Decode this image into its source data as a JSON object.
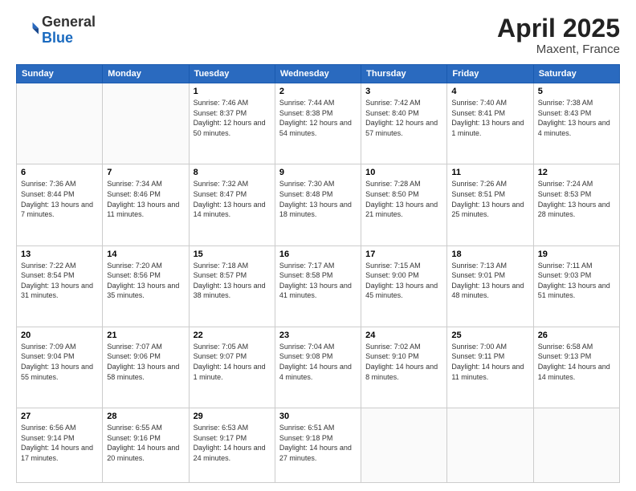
{
  "header": {
    "logo_line1": "General",
    "logo_line2": "Blue",
    "month": "April 2025",
    "location": "Maxent, France"
  },
  "weekdays": [
    "Sunday",
    "Monday",
    "Tuesday",
    "Wednesday",
    "Thursday",
    "Friday",
    "Saturday"
  ],
  "weeks": [
    [
      {
        "day": "",
        "info": ""
      },
      {
        "day": "",
        "info": ""
      },
      {
        "day": "1",
        "info": "Sunrise: 7:46 AM\nSunset: 8:37 PM\nDaylight: 12 hours and 50 minutes."
      },
      {
        "day": "2",
        "info": "Sunrise: 7:44 AM\nSunset: 8:38 PM\nDaylight: 12 hours and 54 minutes."
      },
      {
        "day": "3",
        "info": "Sunrise: 7:42 AM\nSunset: 8:40 PM\nDaylight: 12 hours and 57 minutes."
      },
      {
        "day": "4",
        "info": "Sunrise: 7:40 AM\nSunset: 8:41 PM\nDaylight: 13 hours and 1 minute."
      },
      {
        "day": "5",
        "info": "Sunrise: 7:38 AM\nSunset: 8:43 PM\nDaylight: 13 hours and 4 minutes."
      }
    ],
    [
      {
        "day": "6",
        "info": "Sunrise: 7:36 AM\nSunset: 8:44 PM\nDaylight: 13 hours and 7 minutes."
      },
      {
        "day": "7",
        "info": "Sunrise: 7:34 AM\nSunset: 8:46 PM\nDaylight: 13 hours and 11 minutes."
      },
      {
        "day": "8",
        "info": "Sunrise: 7:32 AM\nSunset: 8:47 PM\nDaylight: 13 hours and 14 minutes."
      },
      {
        "day": "9",
        "info": "Sunrise: 7:30 AM\nSunset: 8:48 PM\nDaylight: 13 hours and 18 minutes."
      },
      {
        "day": "10",
        "info": "Sunrise: 7:28 AM\nSunset: 8:50 PM\nDaylight: 13 hours and 21 minutes."
      },
      {
        "day": "11",
        "info": "Sunrise: 7:26 AM\nSunset: 8:51 PM\nDaylight: 13 hours and 25 minutes."
      },
      {
        "day": "12",
        "info": "Sunrise: 7:24 AM\nSunset: 8:53 PM\nDaylight: 13 hours and 28 minutes."
      }
    ],
    [
      {
        "day": "13",
        "info": "Sunrise: 7:22 AM\nSunset: 8:54 PM\nDaylight: 13 hours and 31 minutes."
      },
      {
        "day": "14",
        "info": "Sunrise: 7:20 AM\nSunset: 8:56 PM\nDaylight: 13 hours and 35 minutes."
      },
      {
        "day": "15",
        "info": "Sunrise: 7:18 AM\nSunset: 8:57 PM\nDaylight: 13 hours and 38 minutes."
      },
      {
        "day": "16",
        "info": "Sunrise: 7:17 AM\nSunset: 8:58 PM\nDaylight: 13 hours and 41 minutes."
      },
      {
        "day": "17",
        "info": "Sunrise: 7:15 AM\nSunset: 9:00 PM\nDaylight: 13 hours and 45 minutes."
      },
      {
        "day": "18",
        "info": "Sunrise: 7:13 AM\nSunset: 9:01 PM\nDaylight: 13 hours and 48 minutes."
      },
      {
        "day": "19",
        "info": "Sunrise: 7:11 AM\nSunset: 9:03 PM\nDaylight: 13 hours and 51 minutes."
      }
    ],
    [
      {
        "day": "20",
        "info": "Sunrise: 7:09 AM\nSunset: 9:04 PM\nDaylight: 13 hours and 55 minutes."
      },
      {
        "day": "21",
        "info": "Sunrise: 7:07 AM\nSunset: 9:06 PM\nDaylight: 13 hours and 58 minutes."
      },
      {
        "day": "22",
        "info": "Sunrise: 7:05 AM\nSunset: 9:07 PM\nDaylight: 14 hours and 1 minute."
      },
      {
        "day": "23",
        "info": "Sunrise: 7:04 AM\nSunset: 9:08 PM\nDaylight: 14 hours and 4 minutes."
      },
      {
        "day": "24",
        "info": "Sunrise: 7:02 AM\nSunset: 9:10 PM\nDaylight: 14 hours and 8 minutes."
      },
      {
        "day": "25",
        "info": "Sunrise: 7:00 AM\nSunset: 9:11 PM\nDaylight: 14 hours and 11 minutes."
      },
      {
        "day": "26",
        "info": "Sunrise: 6:58 AM\nSunset: 9:13 PM\nDaylight: 14 hours and 14 minutes."
      }
    ],
    [
      {
        "day": "27",
        "info": "Sunrise: 6:56 AM\nSunset: 9:14 PM\nDaylight: 14 hours and 17 minutes."
      },
      {
        "day": "28",
        "info": "Sunrise: 6:55 AM\nSunset: 9:16 PM\nDaylight: 14 hours and 20 minutes."
      },
      {
        "day": "29",
        "info": "Sunrise: 6:53 AM\nSunset: 9:17 PM\nDaylight: 14 hours and 24 minutes."
      },
      {
        "day": "30",
        "info": "Sunrise: 6:51 AM\nSunset: 9:18 PM\nDaylight: 14 hours and 27 minutes."
      },
      {
        "day": "",
        "info": ""
      },
      {
        "day": "",
        "info": ""
      },
      {
        "day": "",
        "info": ""
      }
    ]
  ]
}
